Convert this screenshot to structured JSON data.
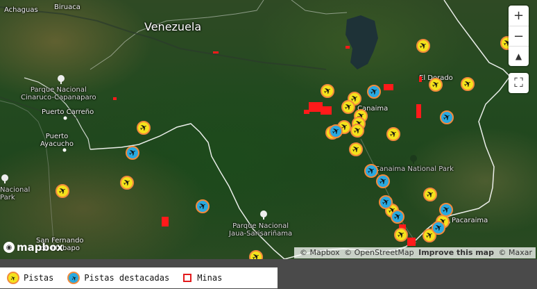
{
  "map": {
    "country_label": "Venezuela",
    "place_labels": [
      {
        "text": "Achaguas"
      },
      {
        "text": "Biruaca"
      },
      {
        "text": "Parque Nacional\nCinaruco-Capanaparo"
      },
      {
        "text": "Puerto Carreño"
      },
      {
        "text": "Puerto\nAyacucho"
      },
      {
        "text": "Parque Nacional\nJaua-Sarisariñama"
      },
      {
        "text": "El Dorado"
      },
      {
        "text": "Canaima National Park"
      },
      {
        "text": "Pacaraima"
      },
      {
        "text": "San Fernando\nde Atabapo"
      },
      {
        "text": "Nacional\nPark"
      },
      {
        "text": "Canaima"
      }
    ],
    "markers": [
      {
        "type": "pista"
      },
      {
        "type": "pista"
      },
      {
        "type": "pista"
      },
      {
        "type": "pista"
      },
      {
        "type": "pista"
      },
      {
        "type": "pista"
      },
      {
        "type": "pista"
      },
      {
        "type": "pista"
      },
      {
        "type": "pista"
      },
      {
        "type": "pista"
      },
      {
        "type": "pista"
      },
      {
        "type": "pista"
      },
      {
        "type": "pista"
      },
      {
        "type": "pista"
      },
      {
        "type": "pista"
      },
      {
        "type": "pista"
      },
      {
        "type": "pista"
      },
      {
        "type": "pista"
      },
      {
        "type": "pista"
      },
      {
        "type": "pista"
      },
      {
        "type": "pista"
      },
      {
        "type": "pista"
      },
      {
        "type": "pista"
      },
      {
        "type": "destacada"
      },
      {
        "type": "destacada"
      },
      {
        "type": "destacada"
      },
      {
        "type": "destacada"
      },
      {
        "type": "destacada"
      },
      {
        "type": "destacada"
      },
      {
        "type": "destacada"
      },
      {
        "type": "destacada"
      },
      {
        "type": "destacada"
      },
      {
        "type": "destacada"
      },
      {
        "type": "destacada"
      }
    ],
    "marker_icon": "airplane-icon",
    "colors": {
      "pista_fill": "#f4e21c",
      "destacada_fill": "#29a9e0",
      "marker_border": "#f28a3c",
      "mine": "#ff1a1a",
      "border_line": "#ffffff"
    }
  },
  "controls": {
    "zoom_in": "+",
    "zoom_out": "−",
    "compass": "▲",
    "fullscreen": "⛶"
  },
  "attribution": {
    "mapbox": "© Mapbox",
    "osm": "© OpenStreetMap",
    "improve": "Improve this map",
    "maxar": "© Maxar"
  },
  "logo": {
    "text": "mapbox"
  },
  "legend": {
    "pistas": "Pistas",
    "pistas_destacadas": "Pistas destacadas",
    "minas": "Minas"
  }
}
